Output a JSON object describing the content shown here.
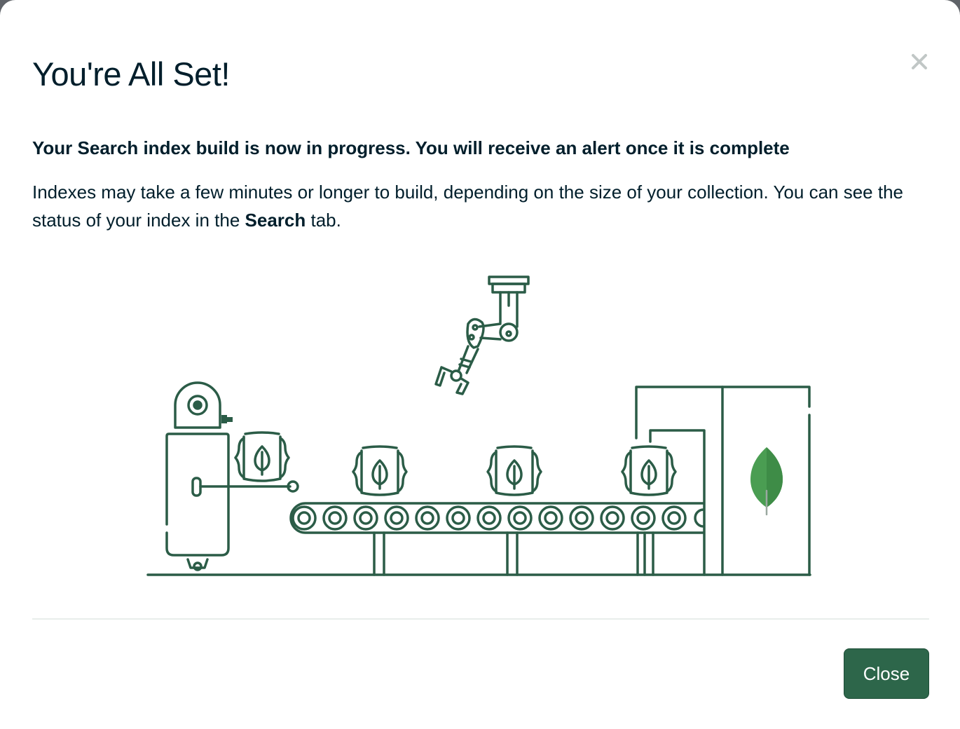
{
  "modal": {
    "title": "You're All Set!",
    "subheading": "Your Search index build is now in progress. You will receive an alert once it is complete",
    "body_before": "Indexes may take a few minutes or longer to build, depending on the size of your collection. You can see the status of your index in the ",
    "body_bold": "Search",
    "body_after": " tab.",
    "close_icon": "close-x-icon",
    "close_button_label": "Close"
  },
  "colors": {
    "accent": "#2d664a",
    "illustration_stroke": "#2b5c47",
    "leaf_green": "#4a9d52",
    "text": "#001e2b"
  },
  "illustration": {
    "name": "conveyor-robot-illustration"
  }
}
